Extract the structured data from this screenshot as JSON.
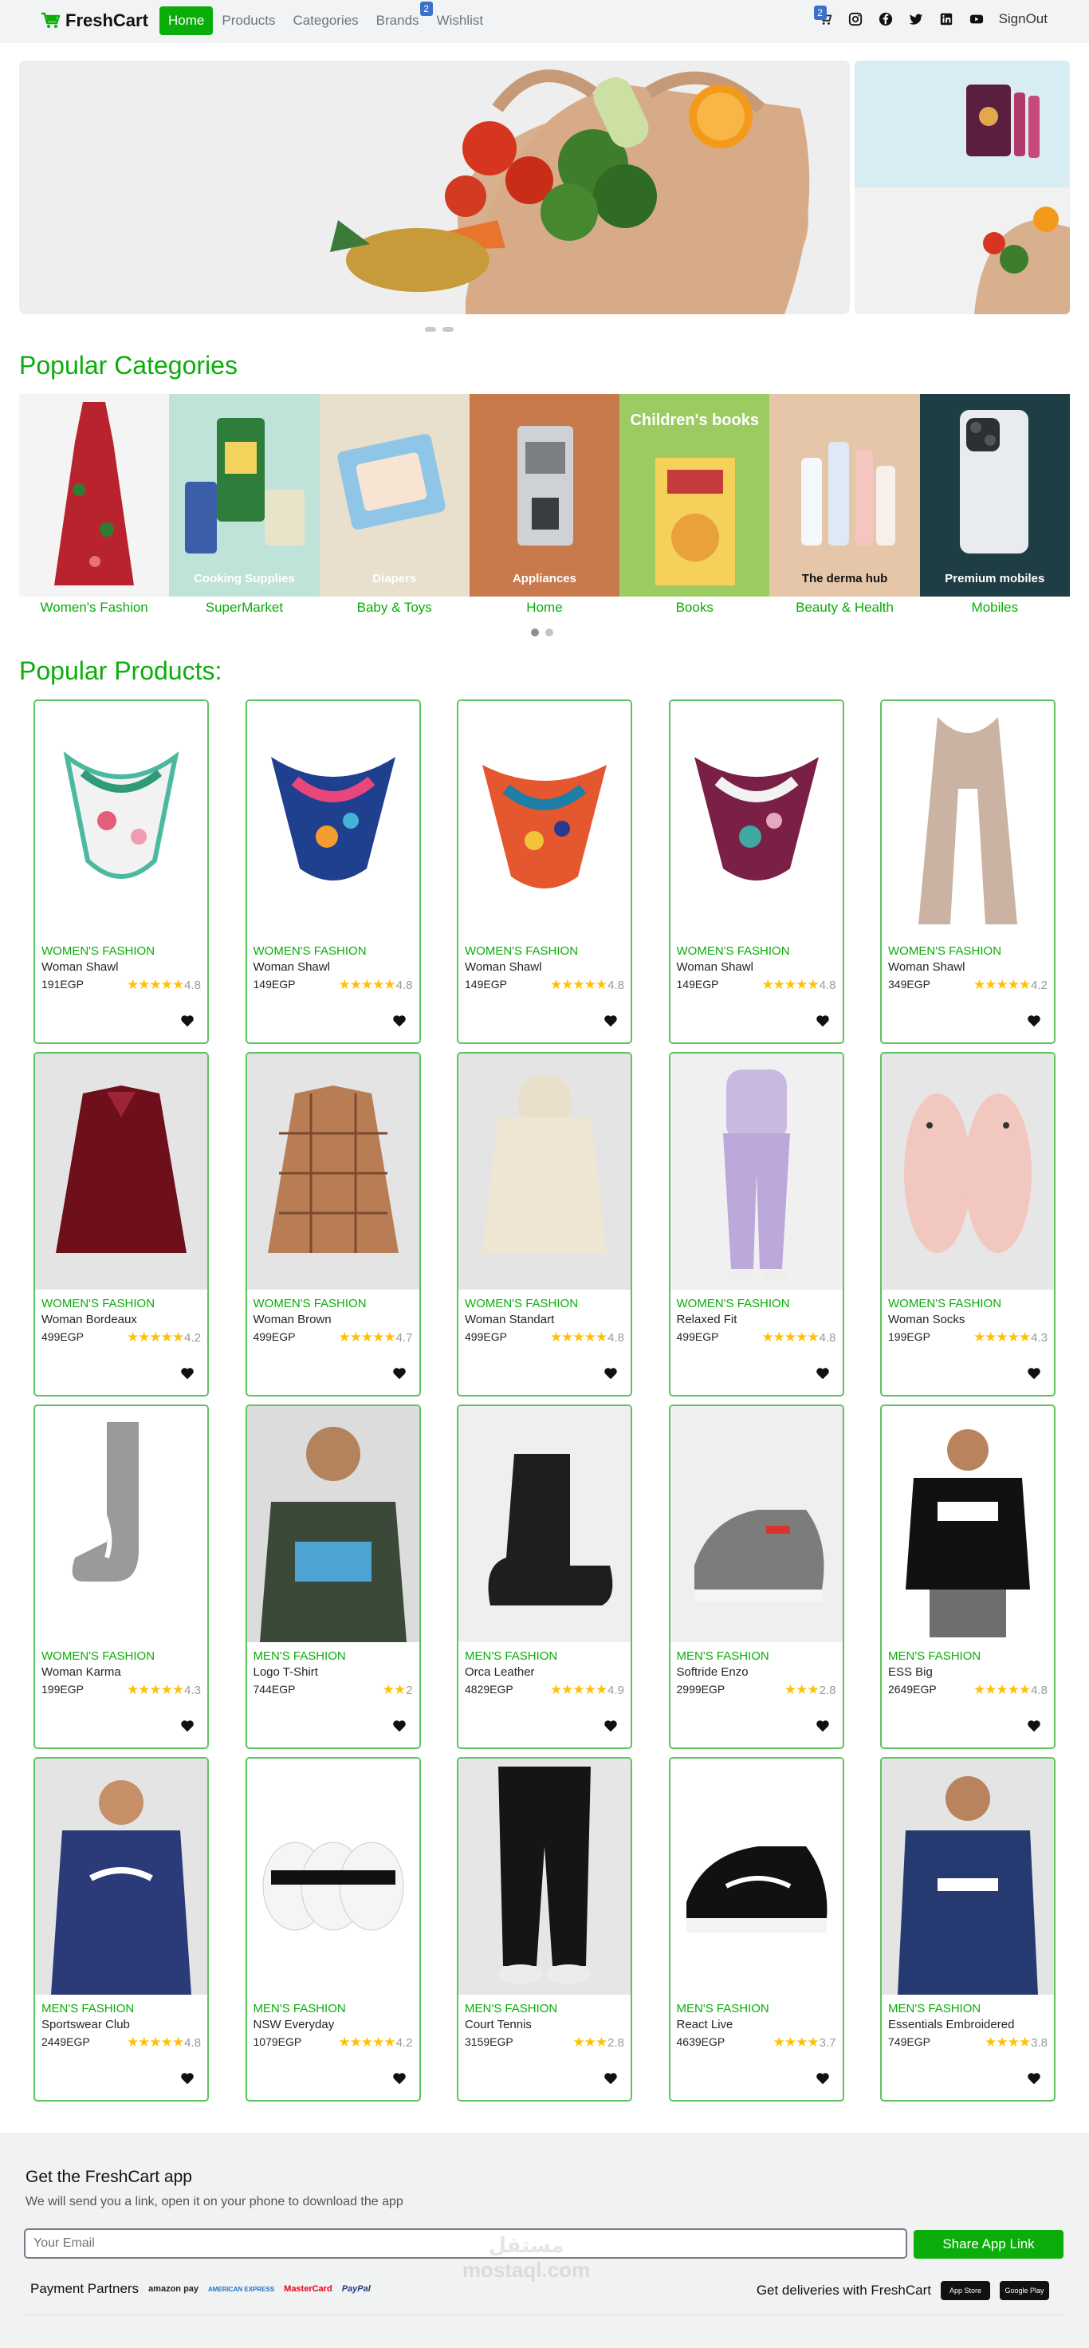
{
  "nav": {
    "brand": "FreshCart",
    "links": [
      "Home",
      "Products",
      "Categories",
      "Brands",
      "Wishlist"
    ],
    "wishlist_count": "2",
    "cart_count": "2",
    "signout": "SignOut",
    "accent_color": "#0aad0a"
  },
  "categories": {
    "title": "Popular Categories",
    "items": [
      {
        "name": "Women's Fashion",
        "overlay": ""
      },
      {
        "name": "SuperMarket",
        "overlay": "Cooking Supplies"
      },
      {
        "name": "Baby & Toys",
        "overlay": "Diapers"
      },
      {
        "name": "Home",
        "overlay": "Appliances"
      },
      {
        "name": "Books",
        "overlay": "Children's books"
      },
      {
        "name": "Beauty & Health",
        "overlay": "The derma hub"
      },
      {
        "name": "Mobiles",
        "overlay": "Premium mobiles"
      }
    ]
  },
  "products": {
    "title": "Popular Products:",
    "items": [
      {
        "category": "Women's Fashion",
        "title": "Woman Shawl",
        "price": "191EGP",
        "stars": "★★★★★",
        "rating": "4.8"
      },
      {
        "category": "Women's Fashion",
        "title": "Woman Shawl",
        "price": "149EGP",
        "stars": "★★★★★",
        "rating": "4.8"
      },
      {
        "category": "Women's Fashion",
        "title": "Woman Shawl",
        "price": "149EGP",
        "stars": "★★★★★",
        "rating": "4.8"
      },
      {
        "category": "Women's Fashion",
        "title": "Woman Shawl",
        "price": "149EGP",
        "stars": "★★★★★",
        "rating": "4.8"
      },
      {
        "category": "Women's Fashion",
        "title": "Woman Shawl",
        "price": "349EGP",
        "stars": "★★★★★",
        "rating": "4.2"
      },
      {
        "category": "Women's Fashion",
        "title": "Woman Bordeaux",
        "price": "499EGP",
        "stars": "★★★★★",
        "rating": "4.2"
      },
      {
        "category": "Women's Fashion",
        "title": "Woman Brown",
        "price": "499EGP",
        "stars": "★★★★★",
        "rating": "4.7"
      },
      {
        "category": "Women's Fashion",
        "title": "Woman Standart",
        "price": "499EGP",
        "stars": "★★★★★",
        "rating": "4.8"
      },
      {
        "category": "Women's Fashion",
        "title": "Relaxed Fit",
        "price": "499EGP",
        "stars": "★★★★★",
        "rating": "4.8"
      },
      {
        "category": "Women's Fashion",
        "title": "Woman Socks",
        "price": "199EGP",
        "stars": "★★★★★",
        "rating": "4.3"
      },
      {
        "category": "Women's Fashion",
        "title": "Woman Karma",
        "price": "199EGP",
        "stars": "★★★★★",
        "rating": "4.3"
      },
      {
        "category": "Men's Fashion",
        "title": "Logo T-Shirt",
        "price": "744EGP",
        "stars": "★★",
        "rating": "2"
      },
      {
        "category": "Men's Fashion",
        "title": "Orca Leather",
        "price": "4829EGP",
        "stars": "★★★★★",
        "rating": "4.9"
      },
      {
        "category": "Men's Fashion",
        "title": "Softride Enzo",
        "price": "2999EGP",
        "stars": "★★★",
        "rating": "2.8"
      },
      {
        "category": "Men's Fashion",
        "title": "ESS Big",
        "price": "2649EGP",
        "stars": "★★★★★",
        "rating": "4.8"
      },
      {
        "category": "Men's Fashion",
        "title": "Sportswear Club",
        "price": "2449EGP",
        "stars": "★★★★★",
        "rating": "4.8"
      },
      {
        "category": "Men's Fashion",
        "title": "NSW Everyday",
        "price": "1079EGP",
        "stars": "★★★★★",
        "rating": "4.2"
      },
      {
        "category": "Men's Fashion",
        "title": "Court Tennis",
        "price": "3159EGP",
        "stars": "★★★",
        "rating": "2.8"
      },
      {
        "category": "Men's Fashion",
        "title": "React Live",
        "price": "4639EGP",
        "stars": "★★★★",
        "rating": "3.7"
      },
      {
        "category": "Men's Fashion",
        "title": "Essentials Embroidered",
        "price": "749EGP",
        "stars": "★★★★",
        "rating": "3.8"
      }
    ]
  },
  "footer": {
    "title": "Get the FreshCart app",
    "subtitle": "We will send you a link, open it on your phone to download the app",
    "email_placeholder": "Your Email",
    "share_label": "Share App Link",
    "partners_label": "Payment Partners",
    "partners": [
      "amazon pay",
      "AMERICAN EXPRESS",
      "MasterCard",
      "PayPal"
    ],
    "deliveries_label": "Get deliveries with FreshCart",
    "stores": [
      "App Store",
      "Google Play"
    ],
    "watermark": "مستقل mostaql.com"
  }
}
